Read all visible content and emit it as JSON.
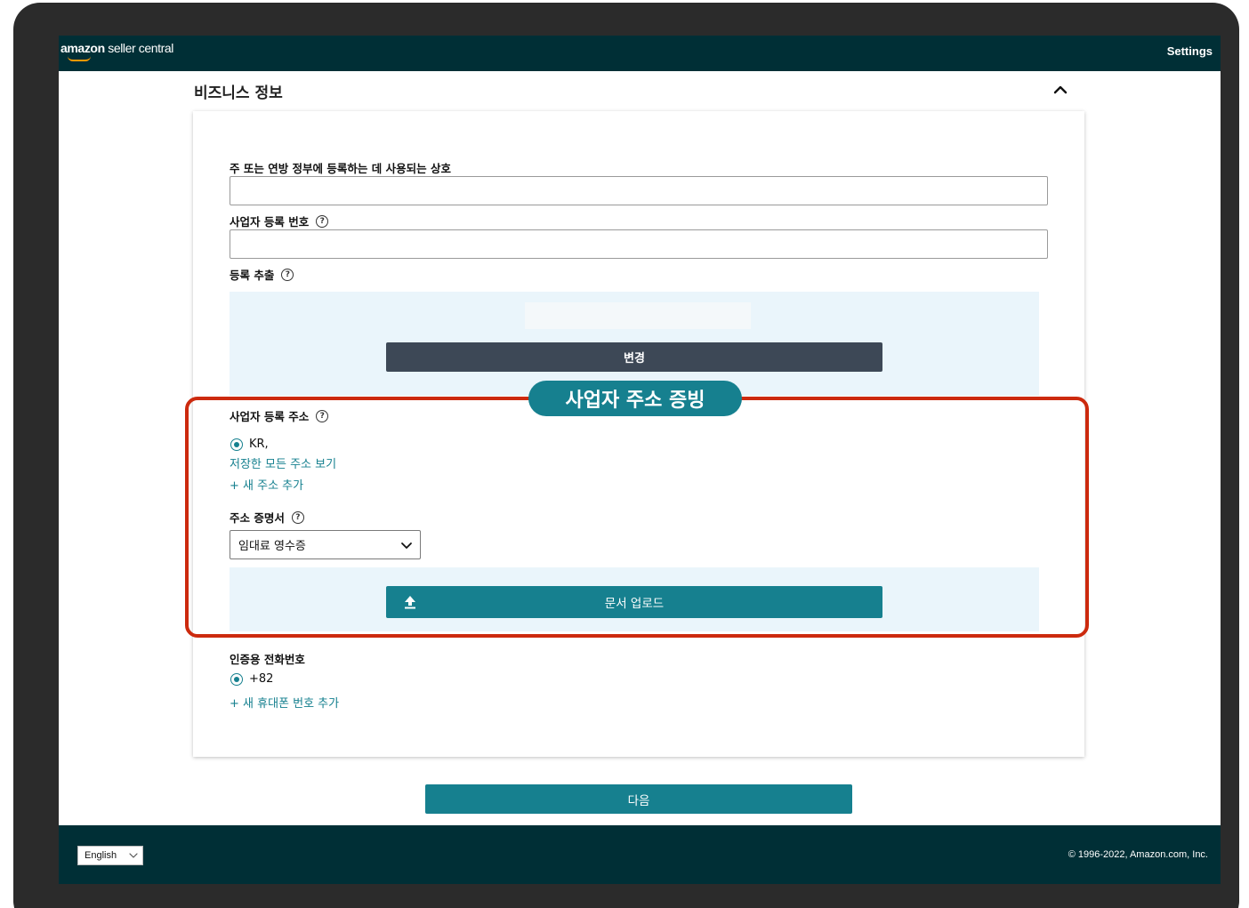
{
  "header": {
    "logo_brand": "amazon",
    "logo_rest": " seller central",
    "settings_label": "Settings"
  },
  "section": {
    "title": "비즈니스 정보",
    "collapse_icon": "chevron-up-icon"
  },
  "form": {
    "business_name_label": "주 또는 연방 정부에 등록하는 데 사용되는 상호",
    "business_name_value": "",
    "registration_number_label": "사업자 등록 번호",
    "registration_number_value": "",
    "registration_extract_label": "등록 추출",
    "change_button": "변경",
    "business_address_label": "사업자 등록 주소",
    "address_option": "KR,",
    "view_all_addresses_link": "저장한 모든 주소 보기",
    "add_address_link": "+ 새 주소 추가",
    "address_proof_label": "주소 증명서",
    "address_proof_selected": "임대료 영수증",
    "upload_button": "문서 업로드",
    "verification_phone_label": "인증용 전화번호",
    "phone_option": "+82",
    "add_phone_link": "+ 새 휴대폰 번호 추가",
    "help_icon_glyph": "?"
  },
  "annotation": {
    "callout_label": "사업자 주소 증빙",
    "highlight_color": "#cc2a0e",
    "callout_color": "#16808f"
  },
  "next_button": "다음",
  "footer": {
    "language": "English",
    "copyright": "© 1996-2022, Amazon.com, Inc."
  },
  "colors": {
    "topbar": "#002f36",
    "accent": "#16808f",
    "dark_button": "#3d4856",
    "panel": "#eaf5fb"
  }
}
